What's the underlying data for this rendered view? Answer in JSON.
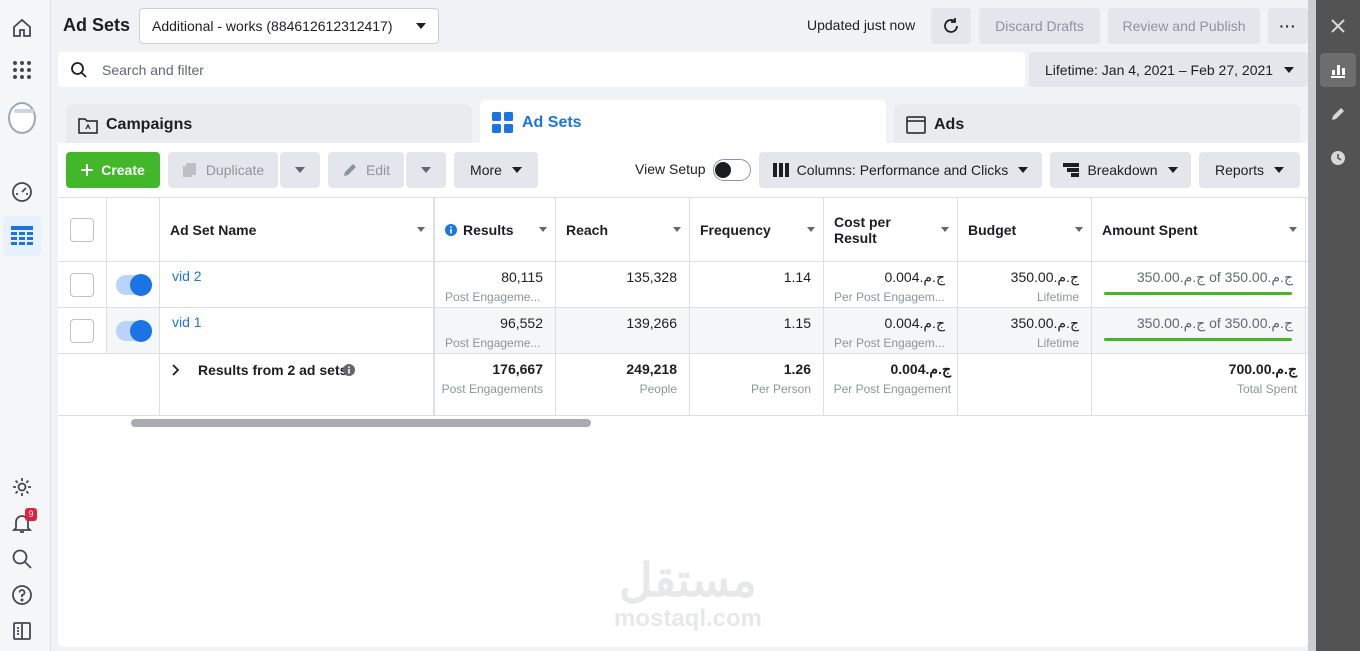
{
  "header": {
    "title": "Ad Sets",
    "account_selector": "Additional - works (884612612312417)",
    "status": "Updated just now",
    "discard_label": "Discard Drafts",
    "publish_label": "Review and Publish",
    "more_label": "···"
  },
  "search": {
    "placeholder": "Search and filter",
    "date_range": "Lifetime: Jan 4, 2021 – Feb 27, 2021"
  },
  "tabs": [
    {
      "label": "Campaigns"
    },
    {
      "label": "Ad Sets"
    },
    {
      "label": "Ads"
    }
  ],
  "toolbar": {
    "create": "Create",
    "duplicate": "Duplicate",
    "edit": "Edit",
    "more": "More",
    "view_setup": "View Setup",
    "columns": "Columns: Performance and Clicks",
    "breakdown": "Breakdown",
    "reports": "Reports"
  },
  "notifications_count": "9",
  "table": {
    "columns": [
      "Ad Set Name",
      "Results",
      "Reach",
      "Frequency",
      "Cost per Result",
      "Budget",
      "Amount Spent"
    ],
    "cost_header_line1": "Cost per",
    "cost_header_line2": "Result",
    "rows": [
      {
        "name": "vid 2",
        "results": "80,115",
        "results_sub": "Post Engageme...",
        "reach": "135,328",
        "frequency": "1.14",
        "cost": "0.004.ج.م",
        "cost_sub": "Per Post Engagem...",
        "budget": "350.00.ج.م",
        "budget_sub": "Lifetime",
        "spent": "350.00.ج.م of 350.00.ج.م"
      },
      {
        "name": "vid 1",
        "results": "96,552",
        "results_sub": "Post Engageme...",
        "reach": "139,266",
        "frequency": "1.15",
        "cost": "0.004.ج.م",
        "cost_sub": "Per Post Engagem...",
        "budget": "350.00.ج.م",
        "budget_sub": "Lifetime",
        "spent": "350.00.ج.م of 350.00.ج.م"
      }
    ],
    "summary": {
      "label": "Results from 2 ad sets",
      "results": "176,667",
      "results_sub": "Post Engagements",
      "reach": "249,218",
      "reach_sub": "People",
      "frequency": "1.26",
      "frequency_sub": "Per Person",
      "cost": "0.004.ج.م",
      "cost_sub": "Per Post Engagement",
      "spent": "700.00.ج.م",
      "spent_sub": "Total Spent"
    }
  },
  "watermark": {
    "arabic": "مستقل",
    "latin": "mostaql.com"
  },
  "colors": {
    "accent": "#1b74e4",
    "create": "#42b72a",
    "alert": "#e41e3f"
  }
}
